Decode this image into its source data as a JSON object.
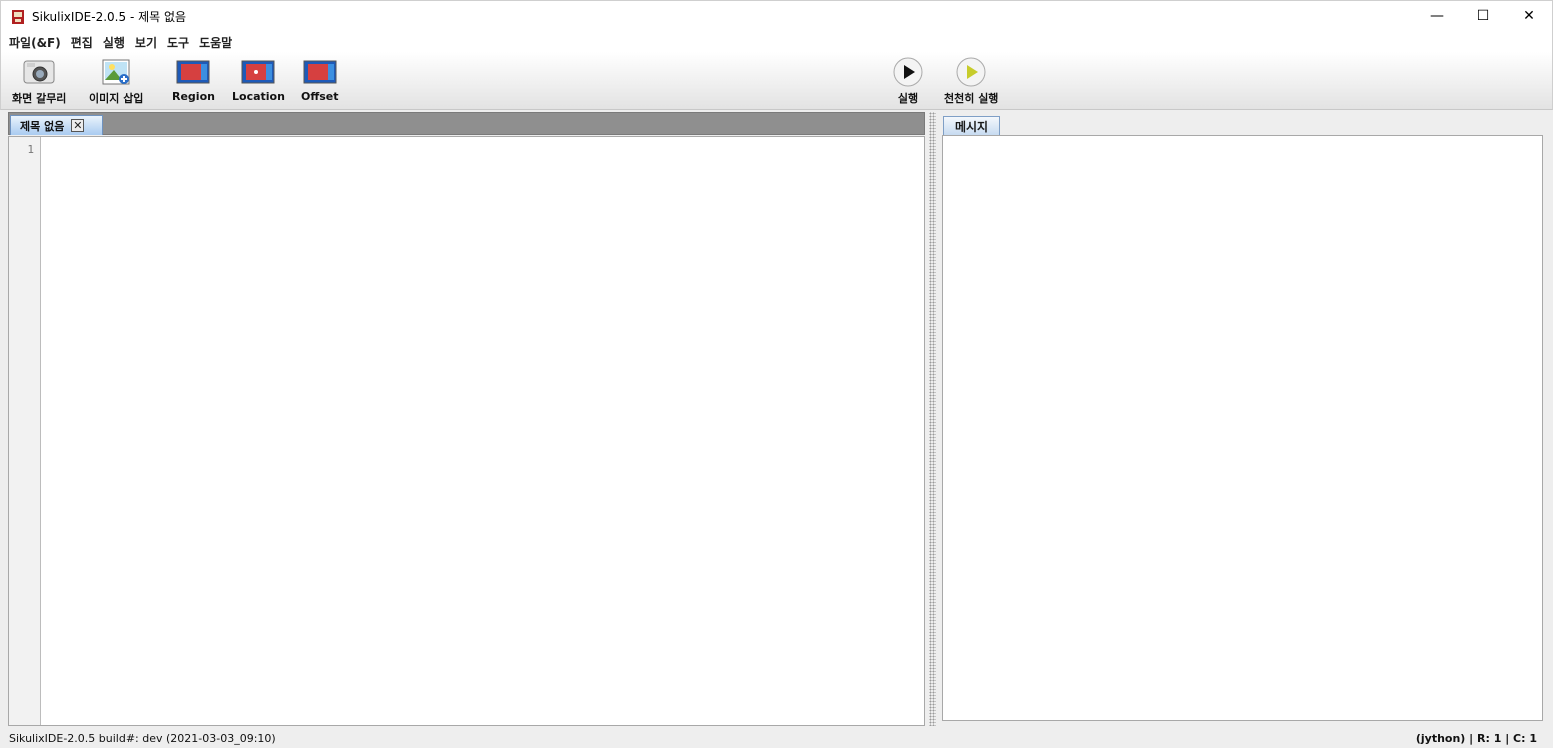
{
  "window": {
    "title": "SikulixIDE-2.0.5 - 제목 없음",
    "minimize": "—",
    "maximize": "☐",
    "close": "✕"
  },
  "menu": [
    "파일(&F)",
    "편집",
    "실행",
    "보기",
    "도구",
    "도움말"
  ],
  "toolbar": {
    "capture": "화면 갈무리",
    "insert_image": "이미지 삽입",
    "region": "Region",
    "location": "Location",
    "offset": "Offset",
    "run": "실행",
    "run_slow": "천천히 실행"
  },
  "editor": {
    "tab_label": "제목 없음",
    "tab_close": "✕",
    "line_number": "1"
  },
  "messages": {
    "tab_label": "메시지"
  },
  "status": {
    "left": "SikulixIDE-2.0.5 build#: dev (2021-03-03_09:10)",
    "right": "(jython) | R: 1 | C: 1"
  },
  "colors": {
    "tab_active": "#a9cbf0",
    "tabstrip": "#8f8f8f",
    "run_green": "#c7cc2b"
  }
}
